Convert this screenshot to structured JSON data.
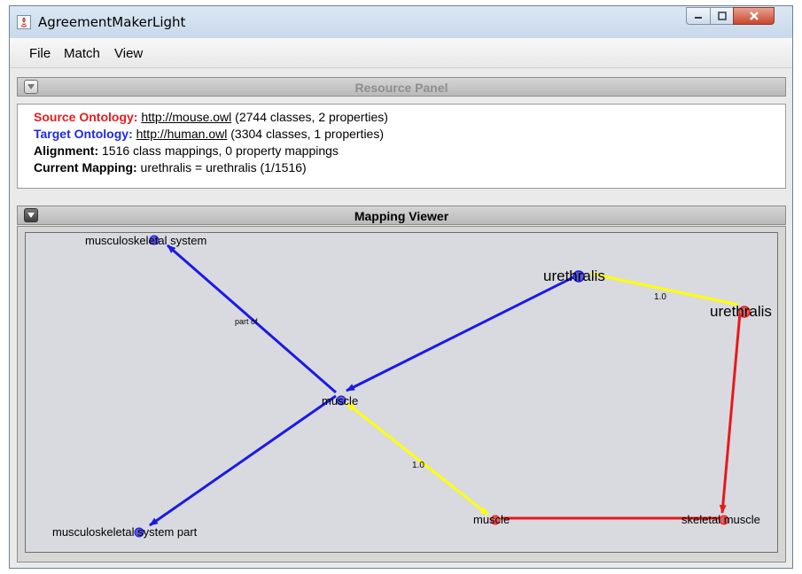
{
  "window": {
    "title": "AgreementMakerLight"
  },
  "menu": {
    "items": [
      "File",
      "Match",
      "View"
    ]
  },
  "resource_panel": {
    "title": "Resource Panel",
    "source_label": "Source Ontology:",
    "source_url": "http://mouse.owl",
    "source_info": " (2744 classes, 2 properties)",
    "target_label": "Target Ontology:",
    "target_url": "http://human.owl",
    "target_info": " (3304 classes, 1 properties)",
    "alignment_label": "Alignment:",
    "alignment_info": " 1516 class mappings, 0 property mappings",
    "current_label": "Current Mapping:",
    "current_info": " urethralis = urethralis (1/1516)"
  },
  "mapping_viewer": {
    "title": "Mapping Viewer",
    "nodes": {
      "musculoskeletal_system": "musculoskeletal system",
      "musculoskeletal_system_part": "musculoskeletal system part",
      "muscle_source": "muscle",
      "urethralis_source": "urethralis",
      "urethralis_target": "urethralis",
      "muscle_target": "muscle",
      "skeletal_muscle": "skeletal muscle"
    },
    "edge_labels": {
      "part_of": "part of",
      "urethralis_score": "1.0",
      "muscle_score": "1.0"
    },
    "colors": {
      "source": "#1a1ae6",
      "target": "#e61a1a",
      "mapping": "#ffff00"
    }
  }
}
